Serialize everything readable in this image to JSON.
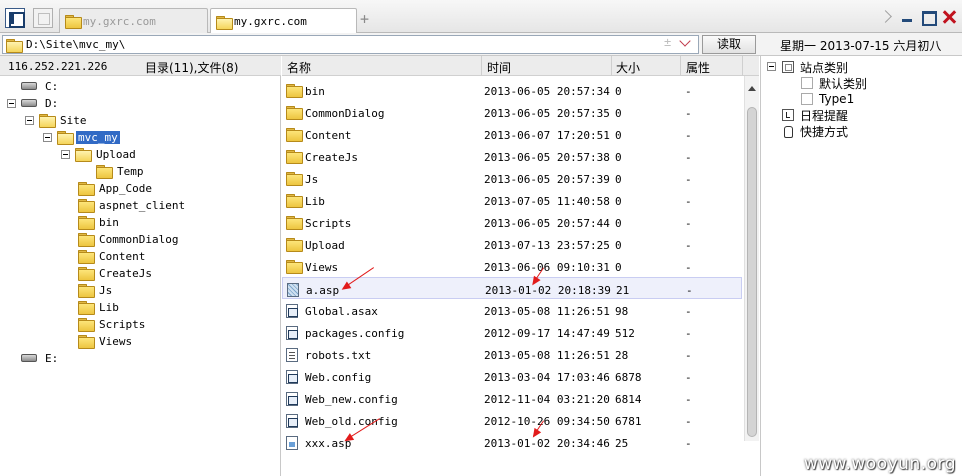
{
  "tabs": [
    {
      "label": "my.gxrc.com",
      "active": false
    },
    {
      "label": "my.gxrc.com",
      "active": true
    }
  ],
  "address": {
    "value": "D:\\Site\\mvc_my\\",
    "plus": "±",
    "read_label": "读取"
  },
  "date_label": "星期一 2013-07-15 六月初八",
  "left": {
    "ip": "116.252.221.226",
    "counts": "目录(11),文件(8)",
    "tree": [
      {
        "label": "C:",
        "type": "drive",
        "depth": 0
      },
      {
        "label": "D:",
        "type": "drive",
        "depth": 0,
        "expanded": true
      },
      {
        "label": "Site",
        "type": "folder",
        "depth": 1,
        "expanded": true
      },
      {
        "label": "mvc_my",
        "type": "folder",
        "depth": 2,
        "expanded": true,
        "selected": true
      },
      {
        "label": "Upload",
        "type": "folder",
        "depth": 3,
        "expanded": true
      },
      {
        "label": "Temp",
        "type": "folder",
        "depth": 4
      },
      {
        "label": "App_Code",
        "type": "folder",
        "depth": 3
      },
      {
        "label": "aspnet_client",
        "type": "folder",
        "depth": 3
      },
      {
        "label": "bin",
        "type": "folder",
        "depth": 3
      },
      {
        "label": "CommonDialog",
        "type": "folder",
        "depth": 3
      },
      {
        "label": "Content",
        "type": "folder",
        "depth": 3
      },
      {
        "label": "CreateJs",
        "type": "folder",
        "depth": 3
      },
      {
        "label": "Js",
        "type": "folder",
        "depth": 3
      },
      {
        "label": "Lib",
        "type": "folder",
        "depth": 3
      },
      {
        "label": "Scripts",
        "type": "folder",
        "depth": 3
      },
      {
        "label": "Views",
        "type": "folder",
        "depth": 3
      },
      {
        "label": "E:",
        "type": "drive",
        "depth": 0
      }
    ]
  },
  "columns": {
    "name": "名称",
    "time": "时间",
    "size": "大小",
    "attr": "属性"
  },
  "files": [
    {
      "name": "bin",
      "time": "2013-06-05 20:57:34",
      "size": "0",
      "attr": "-",
      "icon": "folder"
    },
    {
      "name": "CommonDialog",
      "time": "2013-06-05 20:57:35",
      "size": "0",
      "attr": "-",
      "icon": "folder"
    },
    {
      "name": "Content",
      "time": "2013-06-07 17:20:51",
      "size": "0",
      "attr": "-",
      "icon": "folder"
    },
    {
      "name": "CreateJs",
      "time": "2013-06-05 20:57:38",
      "size": "0",
      "attr": "-",
      "icon": "folder"
    },
    {
      "name": "Js",
      "time": "2013-06-05 20:57:39",
      "size": "0",
      "attr": "-",
      "icon": "folder"
    },
    {
      "name": "Lib",
      "time": "2013-07-05 11:40:58",
      "size": "0",
      "attr": "-",
      "icon": "folder"
    },
    {
      "name": "Scripts",
      "time": "2013-06-05 20:57:44",
      "size": "0",
      "attr": "-",
      "icon": "folder"
    },
    {
      "name": "Upload",
      "time": "2013-07-13 23:57:25",
      "size": "0",
      "attr": "-",
      "icon": "folder"
    },
    {
      "name": "Views",
      "time": "2013-06-06 09:10:31",
      "size": "0",
      "attr": "-",
      "icon": "folder"
    },
    {
      "name": "a.asp",
      "time": "2013-01-02 20:18:39",
      "size": "21",
      "attr": "-",
      "icon": "asp",
      "selected": true
    },
    {
      "name": "Global.asax",
      "time": "2013-05-08 11:26:51",
      "size": "98",
      "attr": "-",
      "icon": "cfg"
    },
    {
      "name": "packages.config",
      "time": "2012-09-17 14:47:49",
      "size": "512",
      "attr": "-",
      "icon": "cfg"
    },
    {
      "name": "robots.txt",
      "time": "2013-05-08 11:26:51",
      "size": "28",
      "attr": "-",
      "icon": "txt"
    },
    {
      "name": "Web.config",
      "time": "2013-03-04 17:03:46",
      "size": "6878",
      "attr": "-",
      "icon": "cfg"
    },
    {
      "name": "Web_new.config",
      "time": "2012-11-04 03:21:20",
      "size": "6814",
      "attr": "-",
      "icon": "cfg"
    },
    {
      "name": "Web_old.config",
      "time": "2012-10-26 09:34:50",
      "size": "6781",
      "attr": "-",
      "icon": "cfg"
    },
    {
      "name": "xxx.asp",
      "time": "2013-01-02 20:34:46",
      "size": "25",
      "attr": "-",
      "icon": "asp2"
    }
  ],
  "right": [
    {
      "label": "站点类别",
      "icon": "cat",
      "depth": 0
    },
    {
      "label": "默认类别",
      "icon": "leaf",
      "depth": 1
    },
    {
      "label": "Type1",
      "icon": "leaf",
      "depth": 1
    },
    {
      "label": "日程提醒",
      "icon": "cal",
      "depth": 0
    },
    {
      "label": "快捷方式",
      "icon": "hand",
      "depth": 0
    }
  ],
  "watermark": "www.wooyun.org",
  "colors": {
    "selection": "#316ac5",
    "arrow": "#e21b1b",
    "close": "#c0121e"
  }
}
